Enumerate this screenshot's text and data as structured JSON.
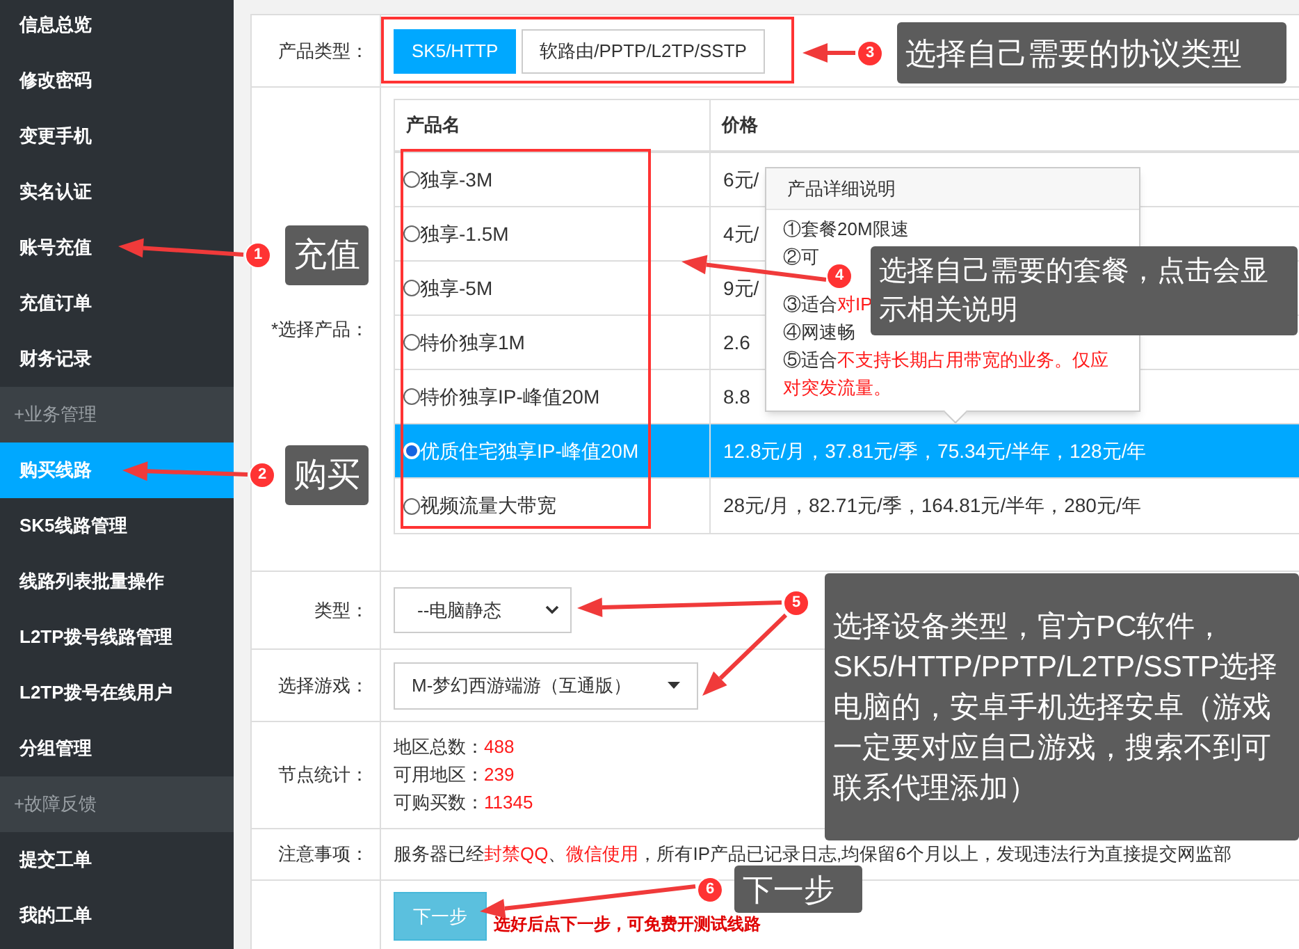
{
  "sidebar": {
    "items": [
      {
        "kind": "item",
        "label": "信息总览",
        "selected": false
      },
      {
        "kind": "item",
        "label": "修改密码",
        "selected": false
      },
      {
        "kind": "item",
        "label": "变更手机",
        "selected": false
      },
      {
        "kind": "item",
        "label": "实名认证",
        "selected": false
      },
      {
        "kind": "item",
        "label": "账号充值",
        "selected": false
      },
      {
        "kind": "item",
        "label": "充值订单",
        "selected": false
      },
      {
        "kind": "item",
        "label": "财务记录",
        "selected": false
      },
      {
        "kind": "group",
        "label": "+业务管理"
      },
      {
        "kind": "item",
        "label": "购买线路",
        "selected": true
      },
      {
        "kind": "item",
        "label": "SK5线路管理",
        "selected": false
      },
      {
        "kind": "item",
        "label": "线路列表批量操作",
        "selected": false
      },
      {
        "kind": "item",
        "label": "L2TP拨号线路管理",
        "selected": false
      },
      {
        "kind": "item",
        "label": "L2TP拨号在线用户",
        "selected": false
      },
      {
        "kind": "item",
        "label": "分组管理",
        "selected": false
      },
      {
        "kind": "group",
        "label": "+故障反馈"
      },
      {
        "kind": "item",
        "label": "提交工单",
        "selected": false
      },
      {
        "kind": "item",
        "label": "我的工单",
        "selected": false
      }
    ]
  },
  "form": {
    "product_type": {
      "label": "产品类型：",
      "tabs": [
        {
          "label": "SK5/HTTP",
          "selected": true
        },
        {
          "label": "软路由/PPTP/L2TP/SSTP",
          "selected": false
        }
      ]
    },
    "select_product": {
      "label": "*选择产品：",
      "columns": [
        "产品名",
        "价格"
      ],
      "rows": [
        {
          "name": "独享-3M",
          "price": "6元/",
          "selected": false
        },
        {
          "name": "独享-1.5M",
          "price": "4元/",
          "selected": false
        },
        {
          "name": "独享-5M",
          "price": "9元/",
          "selected": false
        },
        {
          "name": "特价独享1M",
          "price": "2.6",
          "selected": false
        },
        {
          "name": "特价独享IP-峰值20M",
          "price": "8.8",
          "selected": false
        },
        {
          "name": "优质住宅独享IP-峰值20M",
          "price": "12.8元/月，37.81元/季，75.34元/半年，128元/年",
          "selected": true
        },
        {
          "name": "视频流量大带宽",
          "price": "28元/月，82.71元/季，164.81元/半年，280元/年",
          "selected": false
        }
      ]
    },
    "popover": {
      "title": "产品详细说明",
      "lines": [
        [
          {
            "text": "①套餐20M限速",
            "red": false
          }
        ],
        [
          {
            "text": "②可",
            "red": false
          }
        ],
        [
          {
            "text": "③适合",
            "red": false
          },
          {
            "text": "对IP",
            "red": true
          }
        ],
        [
          {
            "text": "④网速畅",
            "red": false
          }
        ],
        [
          {
            "text": "⑤适合",
            "red": false
          },
          {
            "text": "不支持长期占用带宽的业务。仅应对突发流量。",
            "red": true
          }
        ]
      ]
    },
    "device_type": {
      "label": "类型：",
      "value": "--电脑静态"
    },
    "game": {
      "label": "选择游戏：",
      "value": "M-梦幻西游端游（互通版）"
    },
    "node_stats": {
      "label": "节点统计：",
      "entries": [
        {
          "label": "地区总数：",
          "value": "488"
        },
        {
          "label": "可用地区：",
          "value": "239"
        },
        {
          "label": "可购买数：",
          "value": "11345"
        }
      ]
    },
    "notes": {
      "label": "注意事项：",
      "segments": [
        {
          "text": "服务器已经",
          "red": false
        },
        {
          "text": "封禁QQ",
          "red": true
        },
        {
          "text": "、",
          "red": false
        },
        {
          "text": "微信使用",
          "red": true
        },
        {
          "text": "，所有IP产品已记录日志,均保留6个月以上，发现违法行为直接提交网监部",
          "red": false
        }
      ]
    },
    "next_button": "下一步",
    "next_hint": "选好后点下一步，可免费开测试线路"
  },
  "annotations": [
    {
      "number": "1",
      "text": "充值"
    },
    {
      "number": "2",
      "text": "购买"
    },
    {
      "number": "3",
      "text": "选择自己需要的协议类型"
    },
    {
      "number": "4",
      "text": "选择自己需要的套餐，点击会显示相关说明"
    },
    {
      "number": "5",
      "text": "选择设备类型，官方PC软件，SK5/HTTP/PPTP/L2TP/SSTP选择电脑的，安卓手机选择安卓（游戏一定要对应自己游戏，搜索不到可联系代理添加）"
    },
    {
      "number": "6",
      "text": "下一步"
    }
  ]
}
